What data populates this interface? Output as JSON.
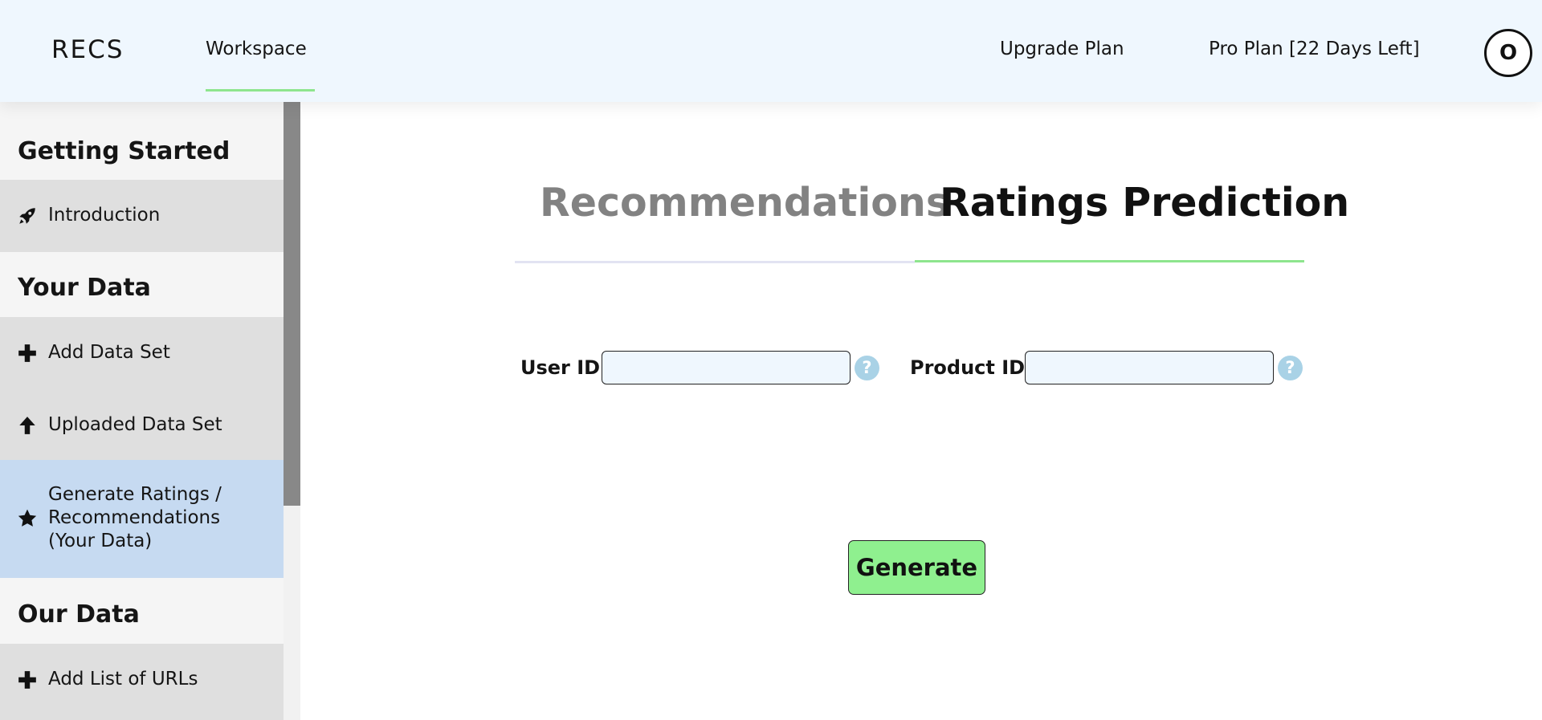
{
  "header": {
    "logo": "RECS",
    "nav_workspace": "Workspace",
    "upgrade": "Upgrade Plan",
    "plan": "Pro Plan [22 Days Left]",
    "avatar_letter": "O"
  },
  "sidebar": {
    "sections": [
      {
        "title": "Getting Started",
        "items": [
          {
            "label": "Introduction",
            "icon": "rocket-icon"
          }
        ]
      },
      {
        "title": "Your Data",
        "items": [
          {
            "label": "Add Data Set",
            "icon": "plus-icon"
          },
          {
            "label": "Uploaded Data Set",
            "icon": "arrow-up-icon"
          },
          {
            "label": "Generate Ratings / Recommendations (Your Data)",
            "label_lines": [
              "Generate Ratings /",
              "Recommendations",
              "(Your Data)"
            ],
            "icon": "star-icon",
            "active": true
          }
        ]
      },
      {
        "title": "Our Data",
        "items": [
          {
            "label": "Add List of URLs",
            "icon": "plus-icon"
          }
        ]
      }
    ]
  },
  "tabs": {
    "recommendations": "Recommendations",
    "ratings": "Ratings Prediction",
    "active": "ratings"
  },
  "form": {
    "user_label": "User ID:",
    "user_value": "",
    "product_label": "Product ID:",
    "product_value": "",
    "help_glyph": "?"
  },
  "generate_label": "Generate",
  "colors": {
    "header_bg": "#eff7fe",
    "accent_green": "#8ee58e",
    "active_item_bg": "#c6daf1",
    "button_green": "#8ff08f"
  }
}
